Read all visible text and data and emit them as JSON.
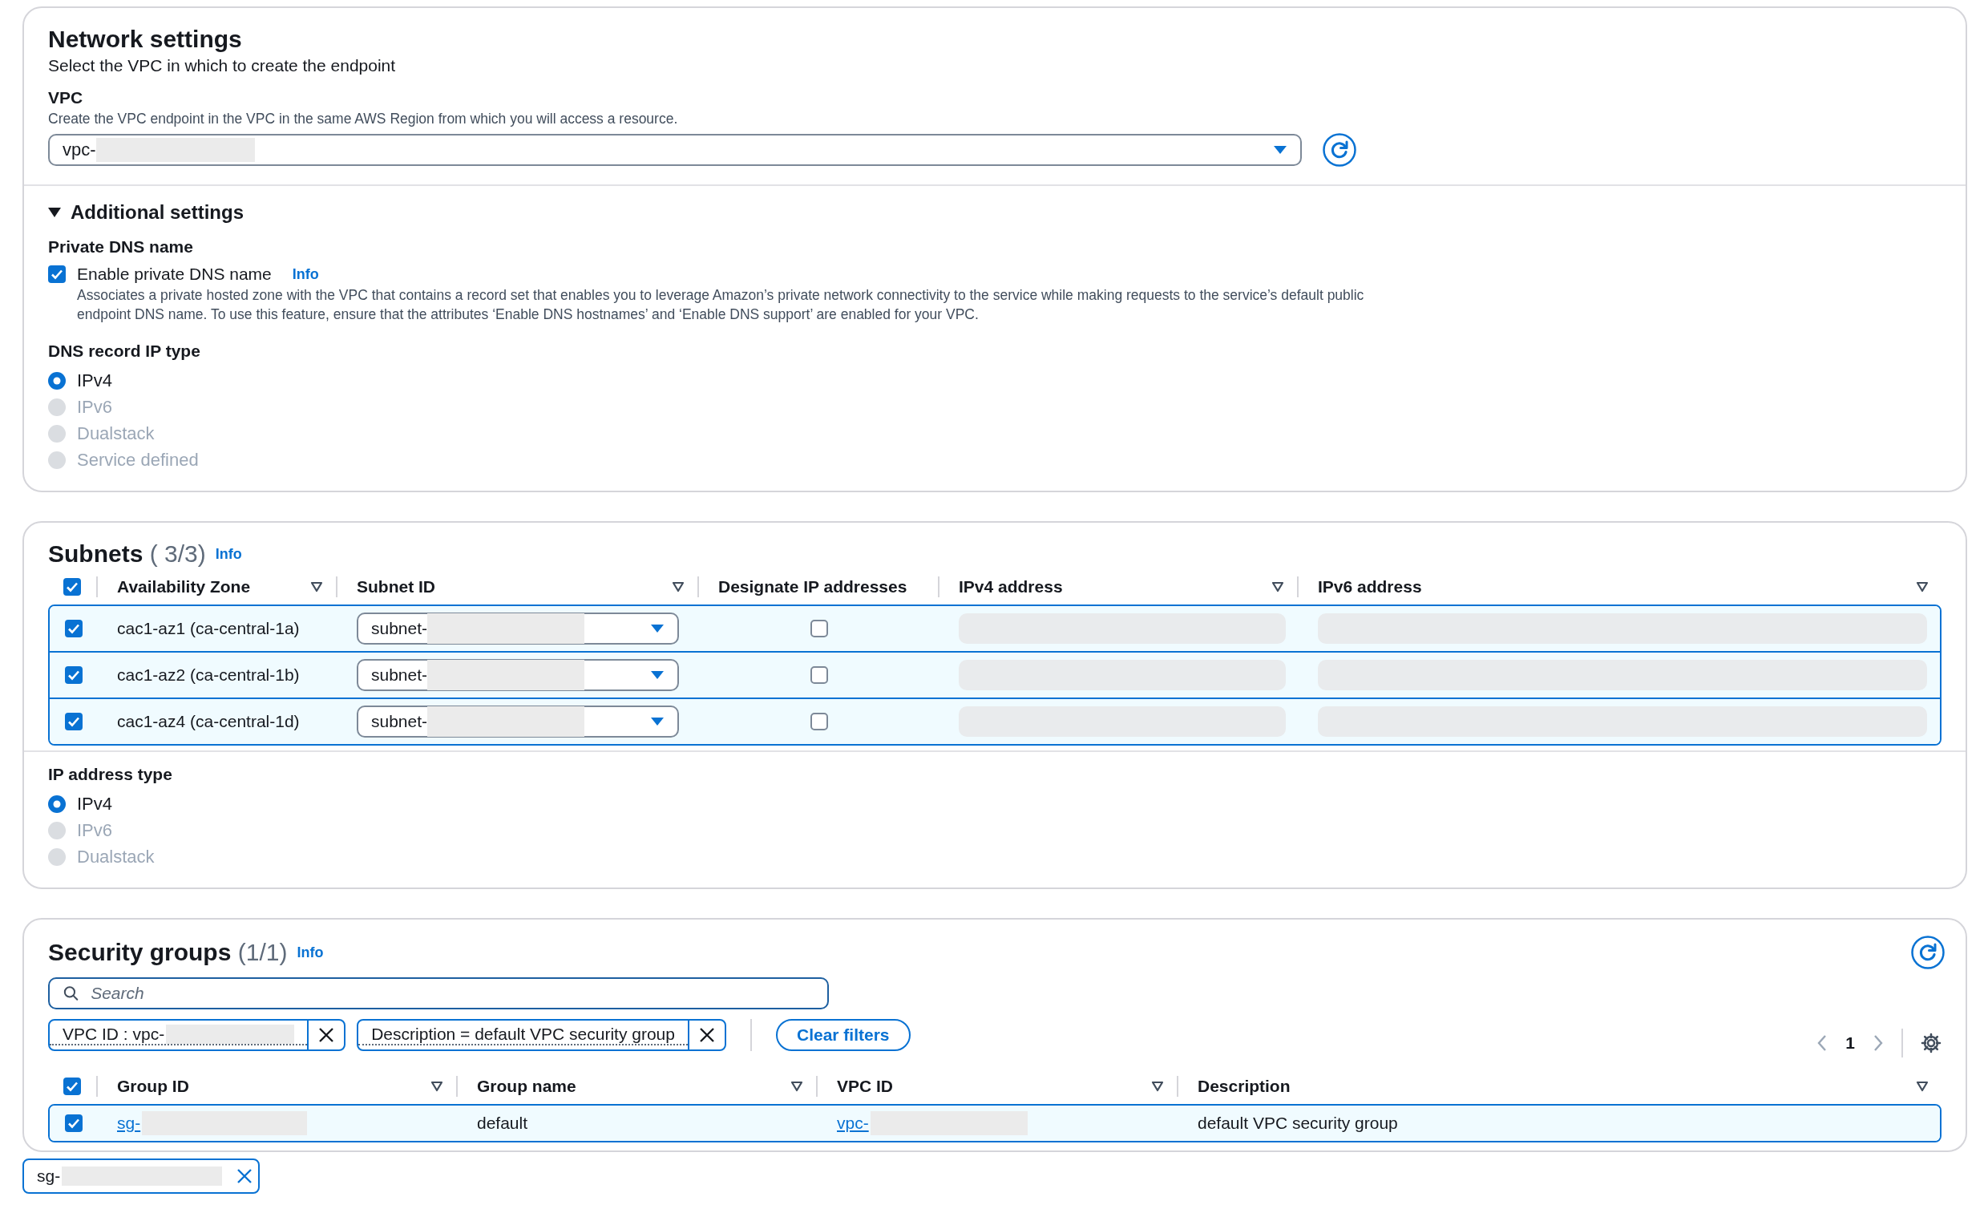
{
  "network_settings": {
    "title": "Network settings",
    "description": "Select the VPC in which to create the endpoint",
    "vpc": {
      "label": "VPC",
      "description": "Create the VPC endpoint in the VPC in the same AWS Region from which you will access a resource.",
      "value": "vpc-"
    },
    "additional_settings": {
      "title": "Additional settings",
      "expanded": true,
      "private_dns_name": {
        "label": "Private DNS name",
        "checkbox_label": "Enable private DNS name",
        "checked": true,
        "info": "Info",
        "description": "Associates a private hosted zone with the VPC that contains a record set that enables you to leverage Amazon’s private network connectivity to the service while making requests to the service’s default public endpoint DNS name. To use this feature, ensure that the attributes ‘Enable DNS hostnames’ and ‘Enable DNS support’ are enabled for your VPC."
      },
      "dns_record_ip_type": {
        "label": "DNS record IP type",
        "options": [
          {
            "label": "IPv4",
            "selected": true,
            "disabled": false
          },
          {
            "label": "IPv6",
            "selected": false,
            "disabled": true
          },
          {
            "label": "Dualstack",
            "selected": false,
            "disabled": true
          },
          {
            "label": "Service defined",
            "selected": false,
            "disabled": true
          }
        ]
      }
    }
  },
  "subnets": {
    "title": "Subnets",
    "count": "( 3/3)",
    "info": "Info",
    "all_checked": true,
    "columns": [
      {
        "label": "Availability Zone",
        "sortable": true
      },
      {
        "label": "Subnet ID",
        "sortable": true
      },
      {
        "label": "Designate IP addresses",
        "sortable": false
      },
      {
        "label": "IPv4 address",
        "sortable": true
      },
      {
        "label": "IPv6 address",
        "sortable": true
      }
    ],
    "rows": [
      {
        "selected": true,
        "zone": "cac1-az1 (ca-central-1a)",
        "subnet_id": "subnet-",
        "designate": false
      },
      {
        "selected": true,
        "zone": "cac1-az2 (ca-central-1b)",
        "subnet_id": "subnet-",
        "designate": false
      },
      {
        "selected": true,
        "zone": "cac1-az4 (ca-central-1d)",
        "subnet_id": "subnet-",
        "designate": false
      }
    ],
    "ip_address_type": {
      "label": "IP address type",
      "options": [
        {
          "label": "IPv4",
          "selected": true,
          "disabled": false
        },
        {
          "label": "IPv6",
          "selected": false,
          "disabled": true
        },
        {
          "label": "Dualstack",
          "selected": false,
          "disabled": true
        }
      ]
    }
  },
  "security_groups": {
    "title": "Security groups",
    "count": "(1/1)",
    "info": "Info",
    "search_placeholder": "Search",
    "filters": [
      {
        "text": "VPC ID : vpc-",
        "redacted": true
      },
      {
        "text": "Description = default VPC security group",
        "redacted": false
      }
    ],
    "clear_filters": "Clear filters",
    "page": "1",
    "all_checked": true,
    "columns": [
      {
        "label": "Group ID",
        "sortable": true
      },
      {
        "label": "Group name",
        "sortable": true
      },
      {
        "label": "VPC ID",
        "sortable": true
      },
      {
        "label": "Description",
        "sortable": true
      }
    ],
    "rows": [
      {
        "selected": true,
        "group_id": "sg-",
        "group_name": "default",
        "vpc_id": "vpc-",
        "description": "default VPC security group"
      }
    ]
  },
  "selected_tokens": [
    {
      "text": "sg-"
    }
  ]
}
